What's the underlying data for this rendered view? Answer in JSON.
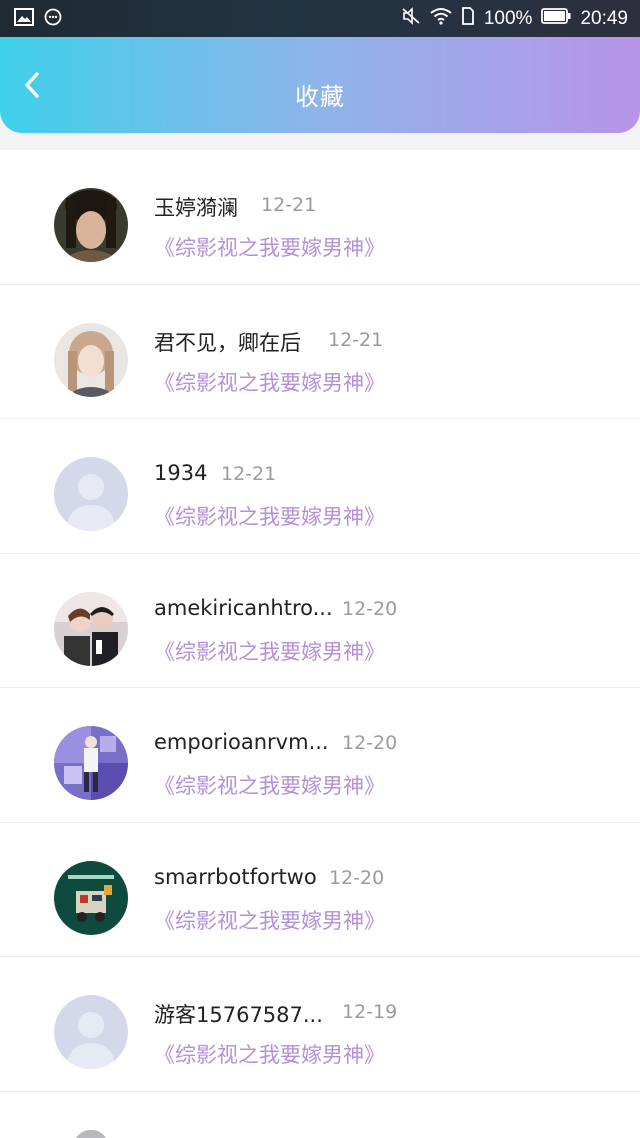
{
  "status_bar": {
    "battery": "100%",
    "time": "20:49"
  },
  "header": {
    "title": "收藏",
    "back_icon": "chevron-left-icon"
  },
  "favorites": [
    {
      "user": "玉婷漪澜",
      "date": "12-21",
      "book": "《综影视之我要嫁男神》",
      "avatar": "photo"
    },
    {
      "user": "君不见，卿在后",
      "date": "12-21",
      "book": "《综影视之我要嫁男神》",
      "avatar": "photo"
    },
    {
      "user": "1934",
      "date": "12-21",
      "book": "《综影视之我要嫁男神》",
      "avatar": "default"
    },
    {
      "user": "amekiricanhtro...",
      "date": "12-20",
      "book": "《综影视之我要嫁男神》",
      "avatar": "photo"
    },
    {
      "user": "emporioanrvm...",
      "date": "12-20",
      "book": "《综影视之我要嫁男神》",
      "avatar": "photo"
    },
    {
      "user": "smarrbotfortwo",
      "date": "12-20",
      "book": "《综影视之我要嫁男神》",
      "avatar": "photo"
    },
    {
      "user": "游客15767587...",
      "date": "12-19",
      "book": "《综影视之我要嫁男神》",
      "avatar": "default"
    }
  ],
  "colors": {
    "header_gradient_start": "#3fd0ea",
    "header_gradient_end": "#b894e8",
    "book_title": "#b590d8",
    "date": "#9a9aa0"
  }
}
